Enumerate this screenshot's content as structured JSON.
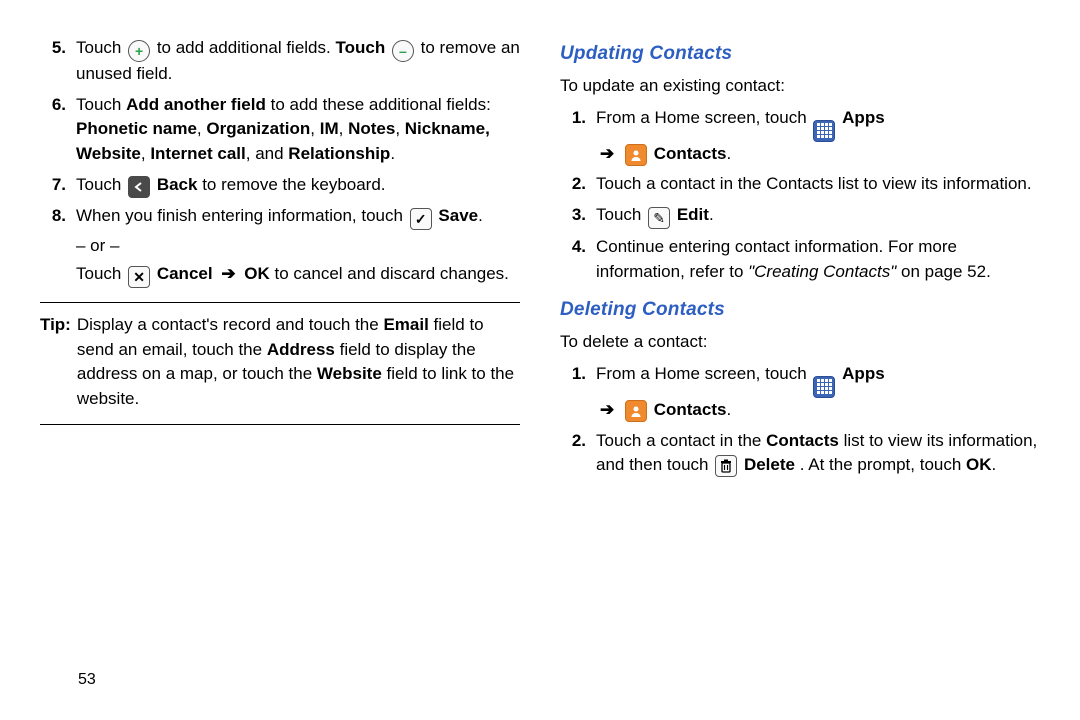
{
  "page_number": "53",
  "left": {
    "steps": [
      {
        "num": "5.",
        "parts": {
          "pre": "Touch ",
          "mid1": " to add additional fields.",
          "touch2": "Touch ",
          "mid2": " to remove an unused field."
        }
      },
      {
        "num": "6.",
        "text_pre": "Touch ",
        "bold1": "Add another field",
        "text_mid": " to add these additional fields: ",
        "bold_list": "Phonetic name",
        "sep1": ", ",
        "bold2": "Organization",
        "sep2": ", ",
        "bold3": "IM",
        "sep3": ", ",
        "bold4": "Notes",
        "sep4": ", ",
        "bold5": "Nickname, Website",
        "sep5": ", ",
        "bold6": "Internet call",
        "sep6": ", and ",
        "bold7": "Relationship",
        "tail": "."
      },
      {
        "num": "7.",
        "pre": "Touch ",
        "bold": "Back",
        "tail": " to remove the keyboard."
      },
      {
        "num": "8.",
        "pre": "When you finish entering information, touch ",
        "bold": "Save",
        "tail": ".",
        "or": "– or –",
        "alt_pre": "Touch ",
        "alt_bold1": "Cancel",
        "alt_arrow": "➔",
        "alt_bold2": "OK",
        "alt_tail": " to cancel and discard changes."
      }
    ],
    "tip": {
      "label": "Tip:",
      "p1": "Display a contact's record and touch the ",
      "b1": "Email",
      "p2": " field to send an email, touch the ",
      "b2": "Address",
      "p3": " field to display the address on a map, or touch the ",
      "b3": "Website",
      "p4": " field to link to the website."
    }
  },
  "right": {
    "section1": {
      "heading": "Updating Contacts",
      "lead": "To update an existing contact:",
      "s1": {
        "num": "1.",
        "pre": "From a Home screen, touch ",
        "apps": "Apps",
        "arrow": "➔",
        "contacts": "Contacts",
        "tail": "."
      },
      "s2": {
        "num": "2.",
        "text": "Touch a contact in the Contacts list to view its information."
      },
      "s3": {
        "num": "3.",
        "pre": "Touch ",
        "bold": "Edit",
        "tail": "."
      },
      "s4": {
        "num": "4.",
        "pre": "Continue entering contact information. For more information, refer to ",
        "ref": "\"Creating Contacts\"",
        "tail": " on page 52."
      }
    },
    "section2": {
      "heading": "Deleting Contacts",
      "lead": "To delete a contact:",
      "s1": {
        "num": "1.",
        "pre": "From a Home screen, touch ",
        "apps": "Apps",
        "arrow": "➔",
        "contacts": "Contacts",
        "tail": "."
      },
      "s2": {
        "num": "2.",
        "pre": "Touch a contact in the ",
        "b1": "Contacts",
        "mid": " list to view its information, and then touch ",
        "b2": "Delete",
        "mid2": ". At the prompt, touch ",
        "b3": "OK",
        "tail": "."
      }
    }
  }
}
